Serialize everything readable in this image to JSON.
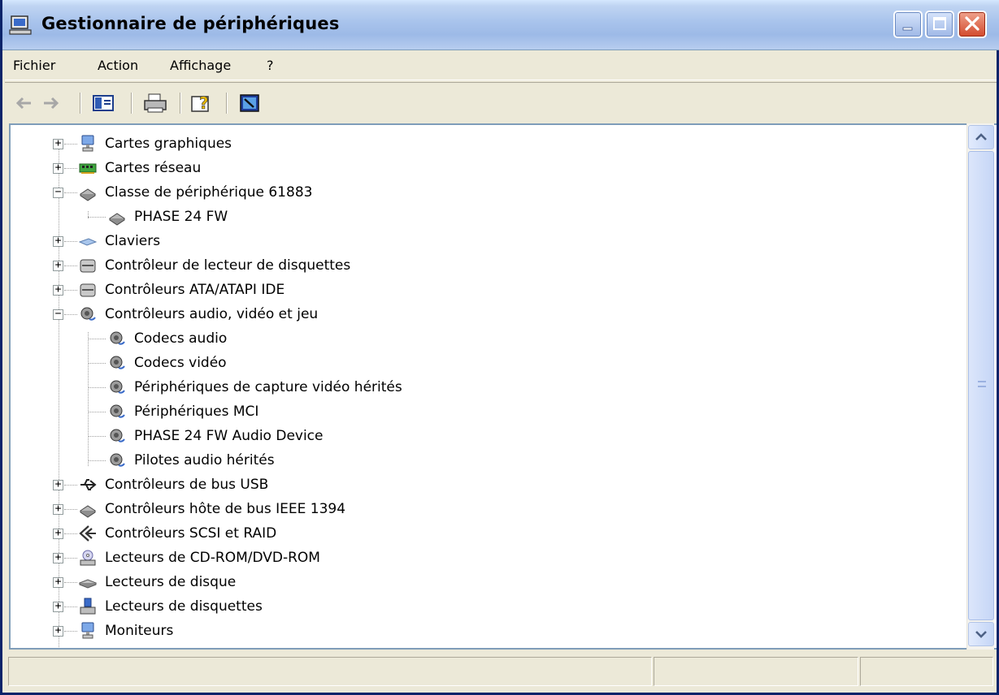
{
  "window": {
    "title": "Gestionnaire de périphériques"
  },
  "menu": {
    "items": [
      "Fichier",
      "Action",
      "Affichage",
      "?"
    ]
  },
  "toolbar": {
    "buttons": [
      "back-arrow-icon",
      "forward-arrow-icon",
      "show-hide-console-tree-icon",
      "print-icon",
      "properties-help-icon",
      "scan-hardware-icon"
    ]
  },
  "tree": {
    "items": [
      {
        "label": "Cartes graphiques",
        "icon": "display-adapter-icon",
        "expander": "+"
      },
      {
        "label": "Cartes réseau",
        "icon": "network-card-icon",
        "expander": "+"
      },
      {
        "label": "Classe de périphérique 61883",
        "icon": "device-class-icon",
        "expander": "−"
      },
      {
        "label": "PHASE 24 FW",
        "icon": "device-class-icon",
        "expander": ""
      },
      {
        "label": "Claviers",
        "icon": "keyboard-icon",
        "expander": "+"
      },
      {
        "label": "Contrôleur de lecteur de disquettes",
        "icon": "disk-controller-icon",
        "expander": "+"
      },
      {
        "label": "Contrôleurs ATA/ATAPI IDE",
        "icon": "disk-controller-icon",
        "expander": "+"
      },
      {
        "label": "Contrôleurs audio, vidéo et jeu",
        "icon": "audio-icon",
        "expander": "−"
      },
      {
        "label": "Codecs audio",
        "icon": "audio-icon",
        "expander": ""
      },
      {
        "label": "Codecs vidéo",
        "icon": "audio-icon",
        "expander": ""
      },
      {
        "label": "Périphériques de capture vidéo hérités",
        "icon": "audio-icon",
        "expander": ""
      },
      {
        "label": "Périphériques MCI",
        "icon": "audio-icon",
        "expander": ""
      },
      {
        "label": "PHASE 24 FW Audio Device",
        "icon": "audio-icon",
        "expander": ""
      },
      {
        "label": "Pilotes audio hérités",
        "icon": "audio-icon",
        "expander": ""
      },
      {
        "label": "Contrôleurs de bus USB",
        "icon": "usb-icon",
        "expander": "+"
      },
      {
        "label": "Contrôleurs hôte de bus IEEE 1394",
        "icon": "device-class-icon",
        "expander": "+"
      },
      {
        "label": "Contrôleurs SCSI et RAID",
        "icon": "scsi-icon",
        "expander": "+"
      },
      {
        "label": "Lecteurs de CD-ROM/DVD-ROM",
        "icon": "cdrom-icon",
        "expander": "+"
      },
      {
        "label": "Lecteurs de disque",
        "icon": "disk-drive-icon",
        "expander": "+"
      },
      {
        "label": "Lecteurs de disquettes",
        "icon": "floppy-drive-icon",
        "expander": "+"
      },
      {
        "label": "Moniteurs",
        "icon": "monitor-icon",
        "expander": "+"
      }
    ]
  },
  "colors": {
    "title_bar": "#A8C3EC",
    "window_bg": "#ECE9D8",
    "close_button": "#D2492C"
  }
}
